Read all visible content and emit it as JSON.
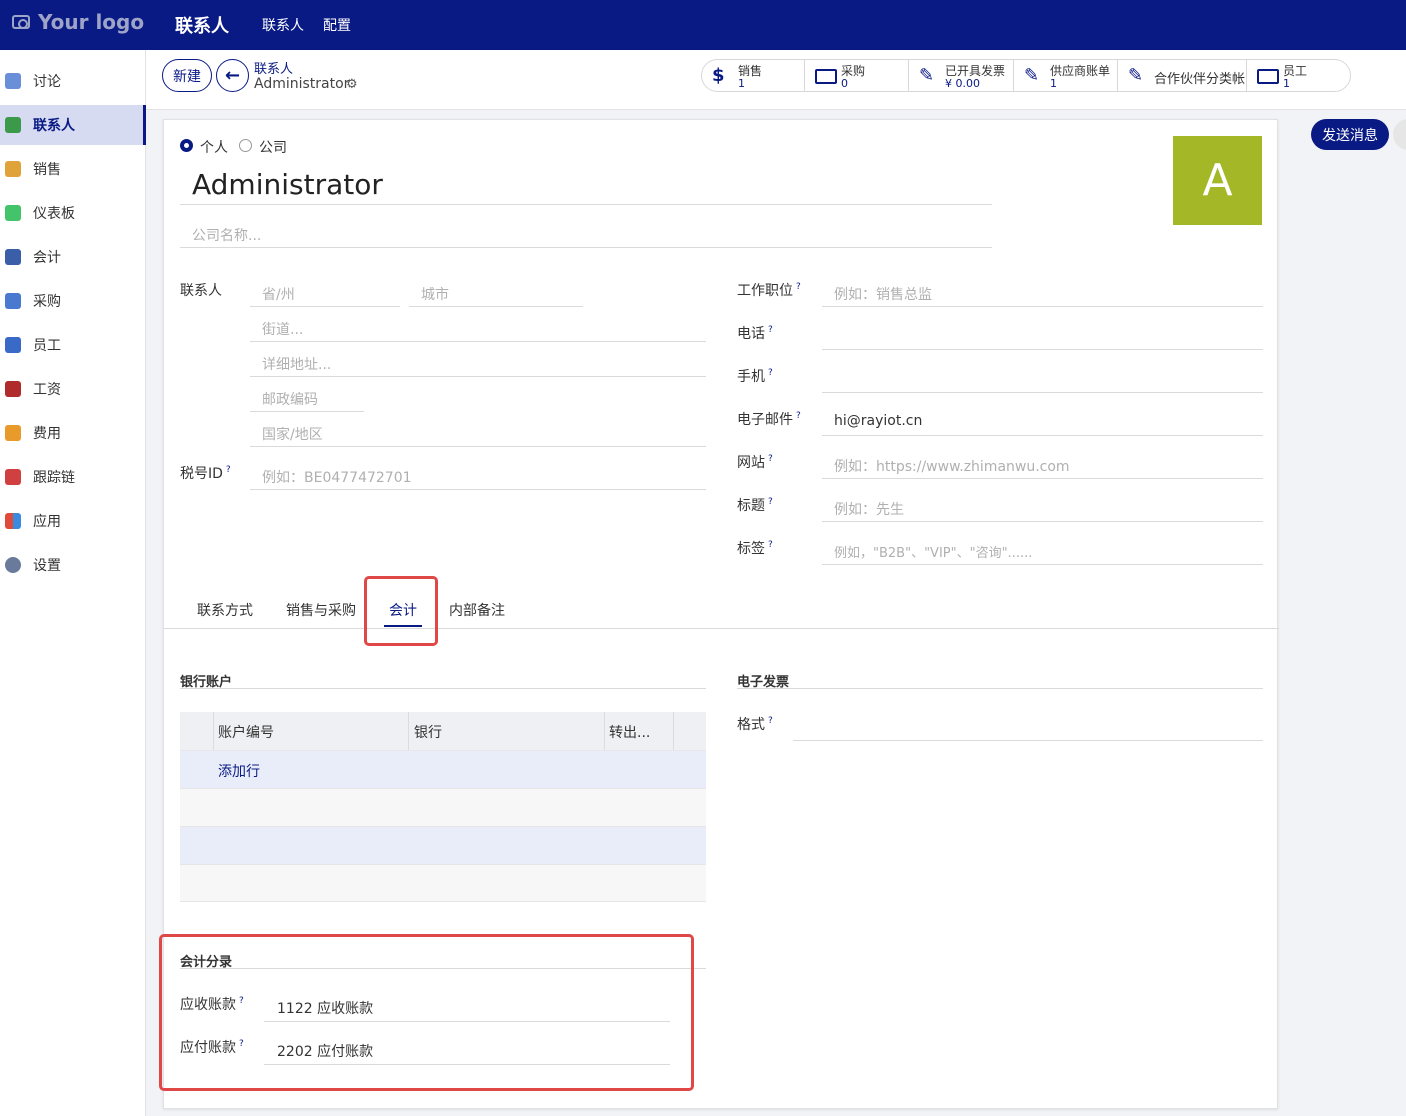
{
  "topbar": {
    "logo": "Your logo",
    "app_title": "联系人",
    "nav": [
      "联系人",
      "配置"
    ]
  },
  "sidebar": {
    "items": [
      {
        "label": "讨论",
        "icon": "chat-icon",
        "color": "#6a8fd9"
      },
      {
        "label": "联系人",
        "icon": "contacts-icon",
        "color": "#3a9a4a"
      },
      {
        "label": "销售",
        "icon": "sales-chart-icon",
        "color": "#e0a33a"
      },
      {
        "label": "仪表板",
        "icon": "dashboard-icon",
        "color": "#44c46a"
      },
      {
        "label": "会计",
        "icon": "accounting-icon",
        "color": "#3a5fa8"
      },
      {
        "label": "采购",
        "icon": "cart-icon",
        "color": "#4a7ad0"
      },
      {
        "label": "员工",
        "icon": "employee-icon",
        "color": "#3a6ac8"
      },
      {
        "label": "工资",
        "icon": "wallet-icon",
        "color": "#b02b2b"
      },
      {
        "label": "费用",
        "icon": "money-bag-icon",
        "color": "#e89a2a"
      },
      {
        "label": "跟踪链",
        "icon": "tracking-icon",
        "color": "#d04040"
      },
      {
        "label": "应用",
        "icon": "apps-icon",
        "color": "#e04a3a"
      },
      {
        "label": "设置",
        "icon": "settings-gear-icon",
        "color": "#6a7a9a"
      }
    ]
  },
  "control": {
    "new_label": "新建",
    "breadcrumb_parent": "联系人",
    "breadcrumb_current": "Administrator"
  },
  "smart_buttons": [
    {
      "label": "销售",
      "value": "1",
      "icon": "$"
    },
    {
      "label": "采购",
      "value": "0",
      "icon": "credit-card-icon"
    },
    {
      "label": "已开具发票",
      "value": "¥ 0.00",
      "icon": "edit-icon"
    },
    {
      "label": "供应商账单",
      "value": "1",
      "icon": "edit-icon"
    },
    {
      "label": "合作伙伴分类帐",
      "value": "",
      "icon": "edit-icon"
    },
    {
      "label": "员工",
      "value": "1",
      "icon": "id-card-icon"
    }
  ],
  "chatter": {
    "send_message": "发送消息"
  },
  "form": {
    "type_person": "个人",
    "type_company": "公司",
    "name": "Administrator",
    "company_placeholder": "公司名称...",
    "avatar_letter": "A",
    "contact_label": "联系人",
    "state_placeholder": "省/州",
    "city_placeholder": "城市",
    "street_placeholder": "街道...",
    "street2_placeholder": "详细地址...",
    "zip_placeholder": "邮政编码",
    "country_placeholder": "国家/地区",
    "vat_label": "税号ID",
    "vat_placeholder": "例如：BE0477472701",
    "job_label": "工作职位",
    "job_placeholder": "例如：销售总监",
    "phone_label": "电话",
    "mobile_label": "手机",
    "email_label": "电子邮件",
    "email_value": "hi@rayiot.cn",
    "website_label": "网站",
    "website_placeholder": "例如：https://www.zhimanwu.com",
    "title_label": "标题",
    "title_placeholder": "例如：先生",
    "tags_label": "标签",
    "tags_placeholder": "例如，\"B2B\"、\"VIP\"、\"咨询\"......"
  },
  "tabs": [
    "联系方式",
    "销售与采购",
    "会计",
    "内部备注"
  ],
  "accounting": {
    "bank_section": "银行账户",
    "columns": [
      "账户编号",
      "银行",
      "转出..."
    ],
    "add_line": "添加行",
    "einvoice_section": "电子发票",
    "format_label": "格式",
    "entries_section": "会计分录",
    "receivable_label": "应收账款",
    "receivable_value": "1122 应收账款",
    "payable_label": "应付账款",
    "payable_value": "2202 应付账款"
  }
}
